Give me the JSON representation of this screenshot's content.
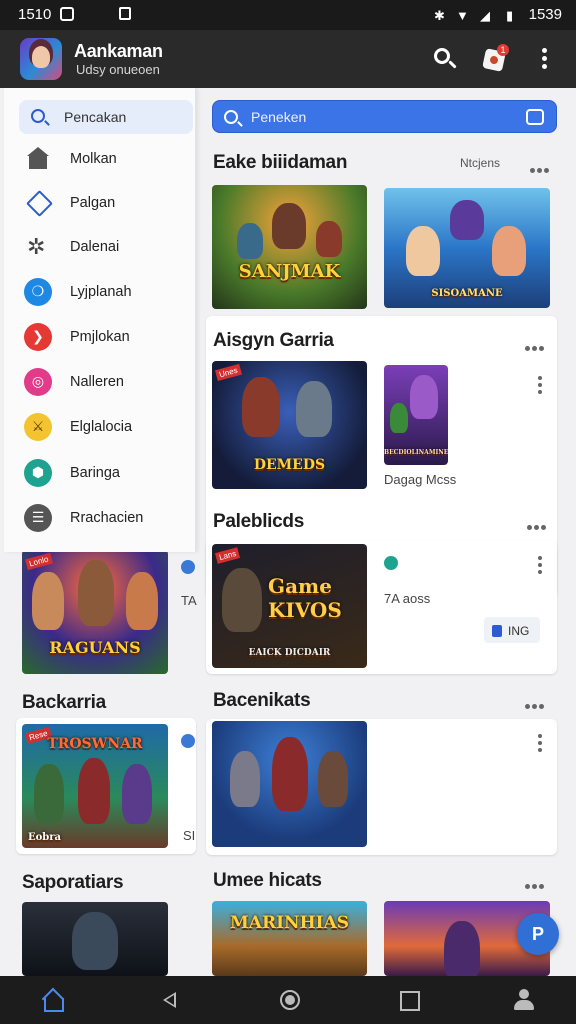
{
  "status_bar": {
    "time_left": "1510",
    "time_right": "1539"
  },
  "app_bar": {
    "title": "Aankaman",
    "subtitle": "Udsy onueoen",
    "notification_count": "1"
  },
  "drawer": {
    "search_placeholder": "Pencakan",
    "items": [
      {
        "label": "Molkan",
        "icon": "home-icon",
        "color": "#555555"
      },
      {
        "label": "Palgan",
        "icon": "tag-icon",
        "color": "#2d5bd0"
      },
      {
        "label": "Dalenai",
        "icon": "gear-icon",
        "color": "#444444"
      },
      {
        "label": "Lyjplanah",
        "icon": "chat-icon",
        "color": "#1e88e5"
      },
      {
        "label": "Pmjlokan",
        "icon": "play-icon",
        "color": "#e53935"
      },
      {
        "label": "Nalleren",
        "icon": "camera-icon",
        "color": "#e23b8a"
      },
      {
        "label": "Elglalocia",
        "icon": "sword-icon",
        "color": "#f4c430"
      },
      {
        "label": "Baringa",
        "icon": "controller-icon",
        "color": "#1fa391"
      },
      {
        "label": "Rrachacien",
        "icon": "document-icon",
        "color": "#555555"
      }
    ]
  },
  "main": {
    "search_placeholder": "Peneken",
    "sections": [
      {
        "title": "Eake biiidaman",
        "meta": "Ntcjens",
        "thumbs": [
          {
            "caption": "SANJMAK",
            "theme": "t1"
          },
          {
            "caption": "SISOAMANE",
            "theme": "t2"
          }
        ]
      },
      {
        "title": "Aisgyn Garria",
        "thumbs": [
          {
            "caption": "DEMEDS",
            "theme": "t3",
            "tag": "Unes"
          },
          {
            "caption": "BECDIOLINAMINE",
            "theme": "t4"
          }
        ],
        "side_text": "Dagag Mcss"
      },
      {
        "title": "Paleblicds",
        "thumbs": [
          {
            "caption_line1": "Game",
            "caption_line2": "KIVOS",
            "footer": "EAICK DICDAIR",
            "theme": "t5",
            "tag": "Lans"
          }
        ],
        "side_text": "7A aoss",
        "pill": "ING"
      },
      {
        "title": "Bacenikats",
        "thumbs": [
          {
            "caption": "",
            "theme": "t6"
          }
        ]
      },
      {
        "title": "Umee hicats",
        "thumbs": [
          {
            "caption": "MARINHIAS",
            "theme": "t10"
          },
          {
            "caption": "",
            "theme": "t11"
          }
        ]
      }
    ]
  },
  "left_lower": {
    "banner_caption": "RAGUANS",
    "banner_tag": "Lonlo",
    "side_letters": "TA",
    "section_title": "Backarria",
    "card_caption": "TROSWNAR",
    "card_footer": "Eobra",
    "card_tag": "Rese",
    "card_side": "SI",
    "bottom_title": "Saporatiars"
  },
  "fab": {
    "label": "P"
  }
}
